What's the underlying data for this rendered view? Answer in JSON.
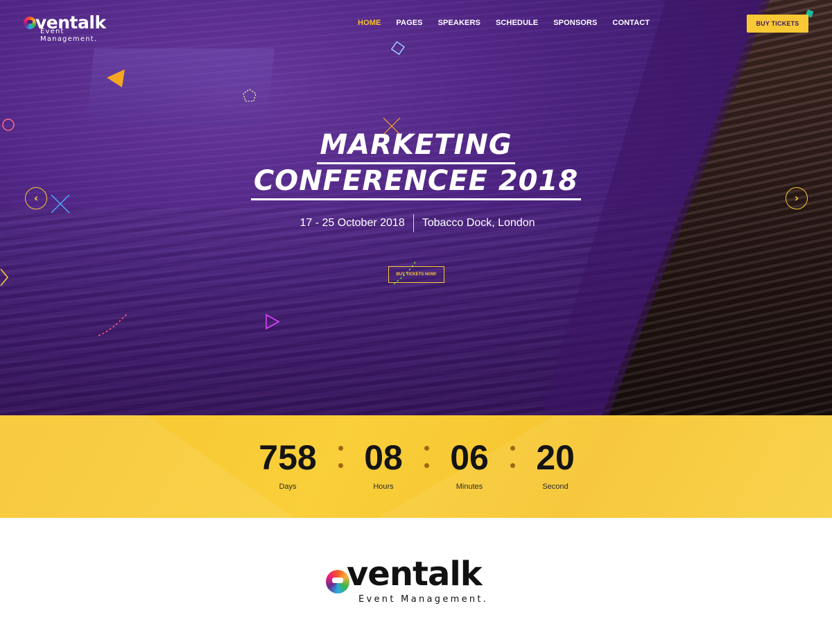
{
  "brand": {
    "name": "ventalk",
    "tagline": "Event Management.",
    "logo_icon": "colorful-e-logo-icon"
  },
  "nav": {
    "items": [
      {
        "label": "HOME",
        "active": true
      },
      {
        "label": "PAGES",
        "active": false
      },
      {
        "label": "SPEAKERS",
        "active": false
      },
      {
        "label": "SCHEDULE",
        "active": false
      },
      {
        "label": "SPONSORS",
        "active": false
      },
      {
        "label": "CONTACT",
        "active": false
      }
    ],
    "cta_label": "BUY TICKETS"
  },
  "hero": {
    "title_line1": "MARKETING",
    "title_line2": "CONFERENCEE 2018",
    "date": "17 - 25 October 2018",
    "location": "Tobacco Dock, London",
    "cta_label": "BUY TICKETS NOW!",
    "prev_icon": "chevron-left-icon",
    "next_icon": "chevron-right-icon"
  },
  "countdown": {
    "units": [
      {
        "value": "758",
        "label": "Days"
      },
      {
        "value": "08",
        "label": "Hours"
      },
      {
        "value": "06",
        "label": "Minutes"
      },
      {
        "value": "20",
        "label": "Second"
      }
    ]
  },
  "colors": {
    "accent": "#f9c935",
    "hero_purple": "#4e2484",
    "countdown_bg": "#f7c52f"
  }
}
